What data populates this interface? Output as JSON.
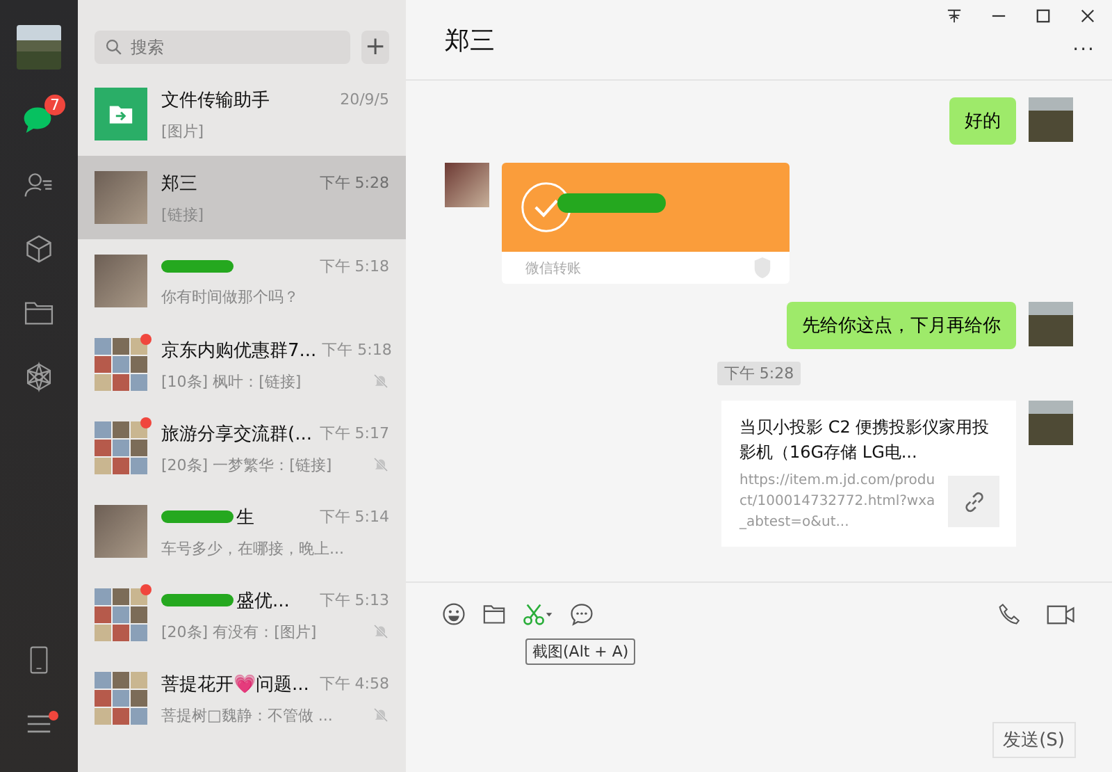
{
  "sidebar": {
    "items": [
      {
        "kind": "chats",
        "selected": true,
        "badge": "7",
        "dot": false
      },
      {
        "kind": "contacts",
        "selected": false,
        "dot": false
      },
      {
        "kind": "favorites",
        "selected": false,
        "dot": false
      },
      {
        "kind": "files",
        "selected": false,
        "dot": false
      },
      {
        "kind": "moments",
        "selected": false,
        "dot": false
      }
    ],
    "bottom_items": [
      {
        "kind": "phone",
        "dot": false
      },
      {
        "kind": "menu",
        "dot": true
      }
    ]
  },
  "search": {
    "placeholder": "搜索"
  },
  "add_button": "+",
  "chats": [
    {
      "avatar": {
        "kind": "file"
      },
      "name": "文件传输助手",
      "time": "20/9/5",
      "preview": "[图片]",
      "selected": false,
      "unread_dot": false,
      "muted": false,
      "redacted": false
    },
    {
      "avatar": {
        "kind": "photo"
      },
      "name": "郑三",
      "time": "下午 5:28",
      "preview": "[链接]",
      "selected": true,
      "unread_dot": false,
      "muted": false,
      "redacted": false
    },
    {
      "avatar": {
        "kind": "photo"
      },
      "time": "下午 5:18",
      "preview": "你有时间做那个吗？",
      "selected": false,
      "unread_dot": false,
      "muted": false,
      "redacted": true
    },
    {
      "avatar": {
        "kind": "group"
      },
      "name": "京东内购优惠群7...",
      "time": "下午 5:18",
      "preview": "[10条] 枫叶：[链接]",
      "selected": false,
      "unread_dot": true,
      "muted": true,
      "redacted": false
    },
    {
      "avatar": {
        "kind": "group"
      },
      "name": "旅游分享交流群(...",
      "time": "下午 5:17",
      "preview": "[20条] 一梦繁华：[链接]",
      "selected": false,
      "unread_dot": true,
      "muted": true,
      "redacted": false
    },
    {
      "avatar": {
        "kind": "photo"
      },
      "name": "生",
      "time": "下午 5:14",
      "preview": "车号多少，在哪接，晚上...",
      "selected": false,
      "unread_dot": false,
      "muted": false,
      "redacted": true
    },
    {
      "avatar": {
        "kind": "group"
      },
      "name": "盛优...",
      "time": "下午 5:13",
      "preview": "[20条] 有没有：[图片]",
      "selected": false,
      "unread_dot": true,
      "muted": true,
      "redacted": true
    },
    {
      "avatar": {
        "kind": "group"
      },
      "name": "菩提花开💗问题...",
      "time": "下午 4:58",
      "preview": "菩提树□魏静：不管做 ...",
      "selected": false,
      "unread_dot": false,
      "muted": true,
      "redacted": false
    }
  ],
  "conversation": {
    "title": "郑三",
    "more": "···",
    "messages": [
      {
        "kind": "text",
        "outgoing": true,
        "text": "好的"
      },
      {
        "kind": "transfer",
        "outgoing": false,
        "footer": "微信转账",
        "received": true
      },
      {
        "kind": "text",
        "outgoing": true,
        "text": "先给你这点，下月再给你"
      },
      {
        "kind": "time",
        "text": "下午 5:28"
      },
      {
        "kind": "link",
        "outgoing": true,
        "title": "当贝小投影 C2 便携投影仪家用投影机（16G存储 LG电...",
        "url": "https://item.m.jd.com/product/100014732772.html?wxa_abtest=o&ut..."
      }
    ]
  },
  "tooltip": "截图(Alt + A)",
  "send_button": "发送(S)"
}
